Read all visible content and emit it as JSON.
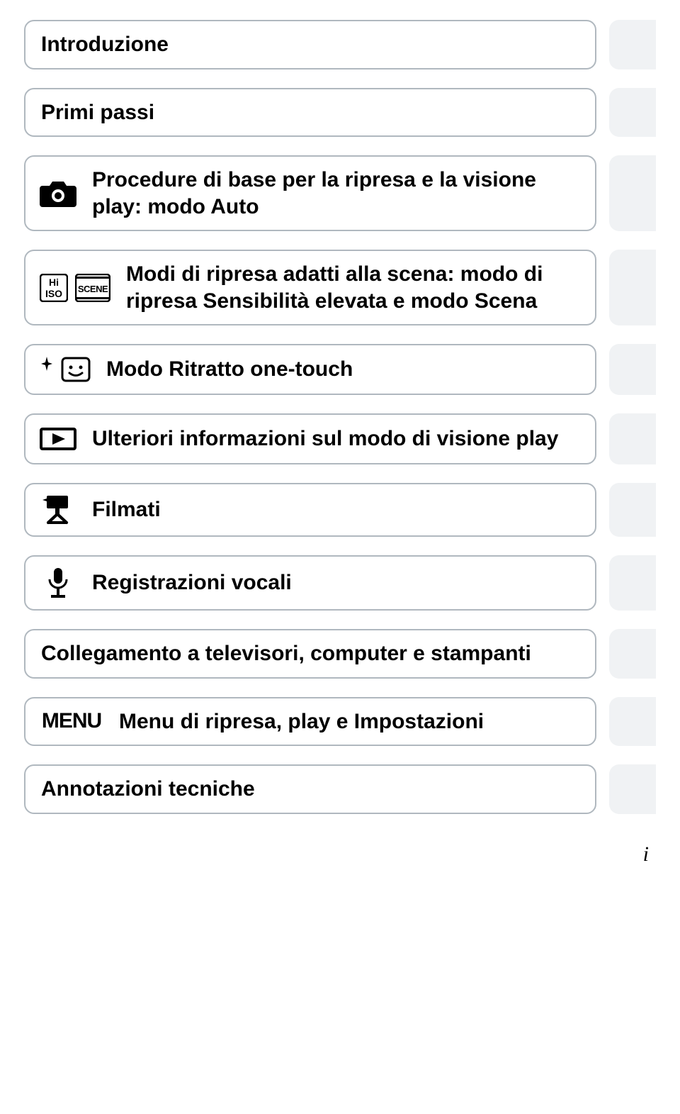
{
  "items": [
    {
      "label": "Introduzione"
    },
    {
      "label": "Primi passi"
    },
    {
      "label": "Procedure di base per la ripresa e la visione play: modo Auto"
    },
    {
      "label": "Modi di ripresa adatti alla scena: modo di ripresa Sensibilità elevata e modo Scena"
    },
    {
      "label": "Modo Ritratto one-touch"
    },
    {
      "label": "Ulteriori informazioni sul modo di visione play"
    },
    {
      "label": "Filmati"
    },
    {
      "label": "Registrazioni vocali"
    },
    {
      "label": "Collegamento a televisori, computer e stampanti"
    },
    {
      "label": "Menu di ripresa, play e Impostazioni"
    },
    {
      "label": "Annotazioni tecniche"
    }
  ],
  "pageNumber": "i"
}
